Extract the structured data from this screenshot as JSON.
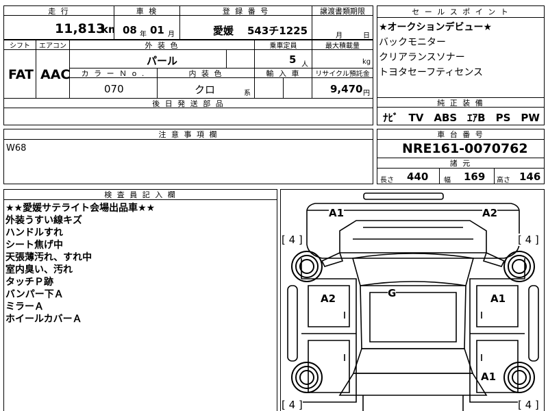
{
  "top": {
    "mileage_label": "走 行",
    "mileage_value": "11,813",
    "mileage_unit": "km",
    "inspection_label": "車 検",
    "inspection_year": "08",
    "inspection_year_unit": "年",
    "inspection_month": "01",
    "inspection_month_unit": "月",
    "registration_label": "登 録 番 号",
    "registration_region": "愛媛",
    "registration_number": "543チ1225",
    "transfer_label": "譲渡書類期限",
    "transfer_month_unit": "月",
    "transfer_day_unit": "日"
  },
  "mid": {
    "shift_label": "シフト",
    "shift_value": "FAT",
    "ac_label": "エアコン",
    "ac_value": "AAC",
    "exterior_color_label": "外 装 色",
    "exterior_color_value": "パール",
    "capacity_label": "乗車定員",
    "capacity_value": "5",
    "capacity_unit": "人",
    "max_load_label": "最大積載量",
    "max_load_unit": "kg",
    "color_no_label": "カ ラ ー Ｎ o .",
    "color_no_value": "070",
    "interior_color_label": "内 装 色",
    "interior_color_value": "クロ",
    "interior_color_suffix": "系",
    "import_label": "輸 入 車",
    "recycle_label": "リサイクル預託金",
    "recycle_value": "9,470",
    "recycle_unit": "円",
    "parts_label": "後 日 発 送 部 品"
  },
  "sales": {
    "label": "セ ー ル ス ポ イ ン ト",
    "points": [
      "★オークションデビュー★",
      "バックモニター",
      "クリアランスソナー",
      "トヨタセーフティセンス"
    ]
  },
  "equipment": {
    "label": "純 正 装 備",
    "items": "ﾅﾋﾞ　TV　ABS　ｴｱB　PS　PW"
  },
  "notes": {
    "label": "注 意 事 項 欄",
    "text": "W68"
  },
  "chassis": {
    "label": "車 台 番 号",
    "value": "NRE161-0070762"
  },
  "specs": {
    "label": "諸 元",
    "length_label": "長さ",
    "length_value": "440",
    "width_label": "幅",
    "width_value": "169",
    "height_label": "高さ",
    "height_value": "146"
  },
  "inspector": {
    "label": "検 査 員 記 入 欄",
    "lines": [
      "★★愛媛サテライト会場出品車★★",
      "外装うすい線キズ",
      "ハンドルすれ",
      "シート焦げ中",
      "天張薄汚れ、すれ中",
      "室内臭い、汚れ",
      "タッチＰ跡",
      "バンパー下Ａ",
      "ミラーＡ",
      "ホイールカバーＡ"
    ]
  },
  "diagram": {
    "tire_marks": [
      "[ 4 ]",
      "[ 4 ]",
      "[ 4 ]",
      "[ 4 ]"
    ],
    "damage": {
      "front_left": "A1",
      "front_right": "A2",
      "left_door": "A2",
      "right_door": "A1",
      "roof": "G",
      "rear_right": "A1"
    }
  }
}
